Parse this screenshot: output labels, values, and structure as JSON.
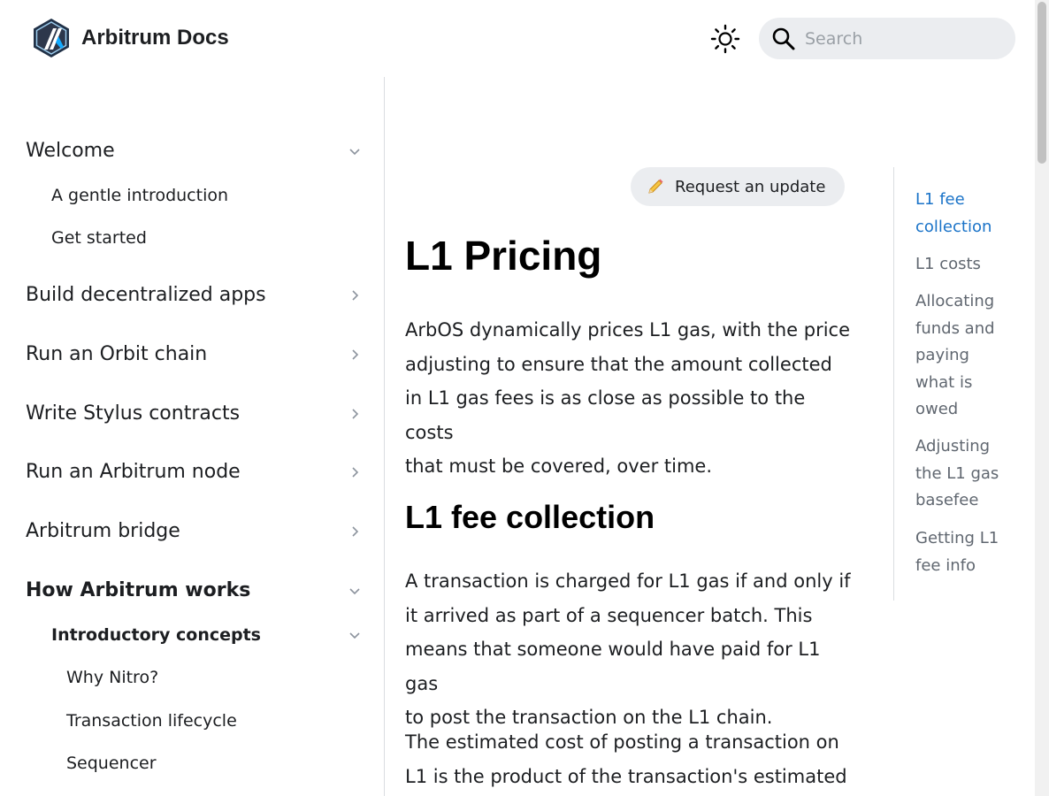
{
  "header": {
    "brand_title": "Arbitrum Docs",
    "search_placeholder": "Search",
    "theme_icon": "sun-icon",
    "search_icon": "search-icon"
  },
  "sidebar": {
    "items": [
      {
        "label": "Welcome",
        "chevron": "down"
      },
      {
        "label": "A gentle introduction"
      },
      {
        "label": "Get started"
      },
      {
        "label": "Build decentralized apps",
        "chevron": "right"
      },
      {
        "label": "Run an Orbit chain",
        "chevron": "right"
      },
      {
        "label": "Write Stylus contracts",
        "chevron": "right"
      },
      {
        "label": "Run an Arbitrum node",
        "chevron": "right"
      },
      {
        "label": "Arbitrum bridge",
        "chevron": "right"
      },
      {
        "label": "How Arbitrum works",
        "chevron": "down"
      },
      {
        "label": "Introductory concepts",
        "chevron": "down"
      },
      {
        "label": "Why Nitro?"
      },
      {
        "label": "Transaction lifecycle"
      },
      {
        "label": "Sequencer"
      }
    ]
  },
  "main": {
    "request_update_label": "Request an update",
    "request_update_icon": "pencil-icon",
    "title": "L1 Pricing",
    "intro_lines": [
      "ArbOS dynamically prices L1 gas, with the price",
      "adjusting to ensure that the amount collected",
      "in L1 gas fees is as close as possible to the costs",
      "that must be covered, over time."
    ],
    "section_heading": "L1 fee collection",
    "section_lines": [
      "A transaction is charged for L1 gas if and only if",
      "it arrived as part of a sequencer batch. This",
      "means that someone would have paid for L1 gas",
      "to post the transaction on the L1 chain."
    ],
    "next_lines": [
      "The estimated cost of posting a transaction on",
      "L1 is the product of the transaction's estimated"
    ]
  },
  "toc": {
    "links": [
      {
        "lines": [
          "L1 fee",
          "collection"
        ],
        "active": true
      },
      {
        "lines": [
          "L1 costs"
        ],
        "active": false
      },
      {
        "lines": [
          "Allocating",
          "funds and",
          "paying",
          "what is",
          "owed"
        ],
        "active": false
      },
      {
        "lines": [
          "Adjusting",
          "the L1 gas",
          "basefee"
        ],
        "active": false
      },
      {
        "lines": [
          "Getting L1",
          "fee info"
        ],
        "active": false
      }
    ]
  },
  "colors": {
    "accent": "#1a73c8",
    "logo_blue": "#213147",
    "logo_light": "#12aaff"
  }
}
